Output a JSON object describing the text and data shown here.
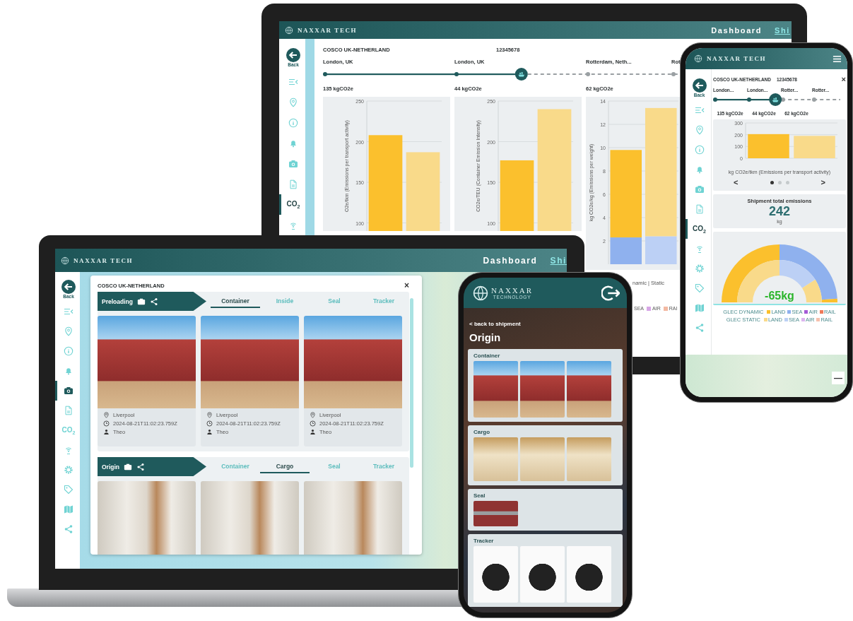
{
  "back_laptop": {
    "header": {
      "brand": "NAXXAR TECH",
      "nav": [
        {
          "label": "Dashboard",
          "selected": false
        },
        {
          "label": "Shi",
          "selected": true
        }
      ]
    },
    "sidebar": [
      {
        "kind": "back",
        "label": "Back",
        "selected": false
      },
      {
        "kind": "collapse",
        "selected": false
      },
      {
        "kind": "pin",
        "selected": false
      },
      {
        "kind": "info",
        "selected": false
      },
      {
        "kind": "bell",
        "selected": false
      },
      {
        "kind": "camera",
        "selected": false
      },
      {
        "kind": "document",
        "selected": false
      },
      {
        "kind": "co2",
        "label": "CO$_{2}$",
        "selected": true
      },
      {
        "kind": "signal",
        "selected": false
      }
    ],
    "panel": {
      "title": "COSCO UK-NETHERLAND",
      "reference": "12345678",
      "route": {
        "stops": [
          {
            "label": "London, UK",
            "reached": true
          },
          {
            "label": "London, UK",
            "reached": true
          },
          {
            "label": "Rotterdam, Neth...",
            "reached": false
          },
          {
            "label": "Rot",
            "reached": false
          }
        ],
        "level": 0.54,
        "emissions": [
          "135 kgCO2e",
          "44 kgCO2e",
          "62 kgCO2e"
        ]
      },
      "charts": [
        {
          "chart_data": {
            "type": "bar",
            "grid": true,
            "ylabel": "O2e/tkm (Emissions per transport activity)",
            "ylim": [
              90,
              250
            ],
            "yticks": [
              100,
              150,
              200,
              250
            ],
            "series": [
              {
                "color": "#fbc02d",
                "values": [
                  208,
                  null
                ]
              },
              {
                "color": "#f9da8a",
                "values": [
                  null,
                  187
                ]
              }
            ]
          }
        },
        {
          "chart_data": {
            "type": "bar",
            "grid": true,
            "ylabel": "CO2e/TEU (Container Emission Intensity)",
            "ylim": [
              90,
              250
            ],
            "yticks": [
              100,
              150,
              200,
              250
            ],
            "series": [
              {
                "color": "#fbc02d",
                "values": [
                  177,
                  null
                ]
              },
              {
                "color": "#f9da8a",
                "values": [
                  null,
                  240
                ]
              }
            ]
          }
        },
        {
          "chart_data": {
            "type": "bar",
            "grid": true,
            "ylabel": "kg CO2e/kg (Emissions per weight)",
            "ylim": [
              0,
              14
            ],
            "yticks": [
              2,
              4,
              6,
              8,
              10,
              12,
              14
            ],
            "stacked": true,
            "series": [
              {
                "color": "#8fb1ee",
                "values": [
                  2.3,
                  null
                ]
              },
              {
                "color": "#fbc02d",
                "values": [
                  7.5,
                  null
                ]
              },
              {
                "color": "#bcd0f5",
                "values": [
                  null,
                  2.4
                ]
              },
              {
                "color": "#f9da8a",
                "values": [
                  null,
                  11
                ]
              }
            ]
          }
        }
      ],
      "legend_caption": "namic | Static",
      "legend": [
        {
          "label": "SEA"
        },
        {
          "label": "AIR",
          "color": "#d7a6e6"
        },
        {
          "label": "RAI",
          "color": "#f3b9a2"
        }
      ]
    }
  },
  "front_laptop": {
    "header": {
      "brand": "NAXXAR TECH",
      "nav": [
        {
          "label": "Dashboard",
          "selected": false
        },
        {
          "label": "Shi",
          "selected": true
        }
      ]
    },
    "sidebar": [
      {
        "kind": "back",
        "label": "Back",
        "selected": false
      },
      {
        "kind": "collapse",
        "selected": false
      },
      {
        "kind": "pin",
        "selected": false
      },
      {
        "kind": "info",
        "selected": false
      },
      {
        "kind": "bell",
        "selected": false
      },
      {
        "kind": "camera",
        "selected": true
      },
      {
        "kind": "document",
        "selected": false
      },
      {
        "kind": "co2",
        "label": "CO$_{2}$",
        "selected": false
      },
      {
        "kind": "signal",
        "selected": false
      },
      {
        "kind": "gear",
        "selected": false
      },
      {
        "kind": "tag",
        "selected": false
      },
      {
        "kind": "map",
        "selected": false
      },
      {
        "kind": "share",
        "selected": false
      }
    ],
    "modal": {
      "title": "COSCO UK-NETHERLAND",
      "close": "×",
      "sections": [
        {
          "label": "Preloading",
          "tabs": [
            {
              "label": "Container",
              "selected": true
            },
            {
              "label": "Inside",
              "selected": false
            },
            {
              "label": "Seal",
              "selected": false
            },
            {
              "label": "Tracker",
              "selected": false
            }
          ],
          "photos": [
            {
              "kind": "container",
              "location": "Liverpool",
              "time": "2024-08-21T11:02:23.759Z",
              "user": "Theo"
            },
            {
              "kind": "container",
              "location": "Liverpool",
              "time": "2024-08-21T11:02:23.759Z",
              "user": "Theo"
            },
            {
              "kind": "container",
              "location": "Liverpool",
              "time": "2024-08-21T11:02:23.759Z",
              "user": "Theo"
            }
          ]
        },
        {
          "label": "Origin",
          "tabs": [
            {
              "label": "Container",
              "selected": false
            },
            {
              "label": "Cargo",
              "selected": true
            },
            {
              "label": "Seal",
              "selected": false
            },
            {
              "label": "Tracker",
              "selected": false
            }
          ],
          "photos": [
            {
              "kind": "interior"
            },
            {
              "kind": "interior"
            },
            {
              "kind": "interior"
            }
          ]
        }
      ]
    }
  },
  "front_phone": {
    "header": {
      "brand": "NAXXAR",
      "tagline": "TECHNOLOGY"
    },
    "back_link": "< back to shipment",
    "title": "Origin",
    "groups": [
      {
        "label": "Container",
        "photos": [
          {
            "kind": "container"
          },
          {
            "kind": "container"
          },
          {
            "kind": "container"
          }
        ]
      },
      {
        "label": "Cargo",
        "photos": [
          {
            "kind": "boxes"
          },
          {
            "kind": "boxes"
          },
          {
            "kind": "boxes"
          }
        ]
      },
      {
        "label": "Seal",
        "photos": [
          {
            "kind": "seal"
          }
        ]
      },
      {
        "label": "Tracker",
        "photos": [
          {
            "kind": "device"
          },
          {
            "kind": "device"
          },
          {
            "kind": "device"
          }
        ]
      }
    ]
  },
  "right_phone": {
    "header": {
      "brand": "NAXXAR TECH"
    },
    "sidebar": [
      {
        "kind": "back",
        "label": "Back",
        "selected": false
      },
      {
        "kind": "collapse",
        "selected": false
      },
      {
        "kind": "pin",
        "selected": false
      },
      {
        "kind": "info",
        "selected": false
      },
      {
        "kind": "bell",
        "selected": false
      },
      {
        "kind": "camera",
        "selected": false
      },
      {
        "kind": "document",
        "selected": false
      },
      {
        "kind": "co2",
        "label": "CO$_{2}$",
        "selected": true
      },
      {
        "kind": "signal",
        "selected": false
      },
      {
        "kind": "gear",
        "selected": false
      },
      {
        "kind": "tag",
        "selected": false
      },
      {
        "kind": "map",
        "selected": false
      },
      {
        "kind": "share",
        "selected": false
      }
    ],
    "panel": {
      "title": "COSCO UK-NETHERLAND",
      "reference": "12345678",
      "close": "×",
      "route": {
        "stops": [
          {
            "label": "London...",
            "reached": true
          },
          {
            "label": "London...",
            "reached": true
          },
          {
            "label": "Rotter...",
            "reached": false
          },
          {
            "label": "Rotter...",
            "reached": false
          }
        ],
        "level": 0.49,
        "emissions": [
          "135 kgCO2e",
          "44 kgCO2e",
          "62 kgCO2e"
        ]
      },
      "chart": {
        "chart_data": {
          "type": "bar",
          "grid": true,
          "xlabel": "kg CO2e/tkm (Emissions per transport activity)",
          "ylim": [
            0,
            300
          ],
          "yticks": [
            0,
            100,
            200,
            300
          ],
          "series": [
            {
              "color": "#fbc02d",
              "values": [
                205,
                null
              ]
            },
            {
              "color": "#f9da8a",
              "values": [
                null,
                190
              ]
            }
          ]
        },
        "prev": "<",
        "next": ">",
        "pages": [
          {
            "selected": true
          },
          {
            "selected": false
          },
          {
            "selected": false
          }
        ]
      },
      "total": {
        "label": "Shipment total emissions",
        "value": "242",
        "unit": "kg"
      },
      "gauge": {
        "value": "-65kg"
      },
      "legend": [
        {
          "label": "GLEC DYNAMIC",
          "items": [
            {
              "label": "LAND",
              "color": "#fbc02d"
            },
            {
              "label": "SEA",
              "color": "#8fb1ee"
            },
            {
              "label": "AIR",
              "color": "#a45ad6"
            },
            {
              "label": "RAIL",
              "color": "#ef7a5a"
            }
          ]
        },
        {
          "label": "GLEC STATIC",
          "items": [
            {
              "label": "LAND",
              "color": "#f9da8a"
            },
            {
              "label": "SEA",
              "color": "#bcd0f5"
            },
            {
              "label": "AIR",
              "color": "#dcb5ef"
            },
            {
              "label": "RAIL",
              "color": "#f6c0ad"
            }
          ]
        }
      ]
    },
    "map": {
      "zoom_out": "—"
    }
  }
}
